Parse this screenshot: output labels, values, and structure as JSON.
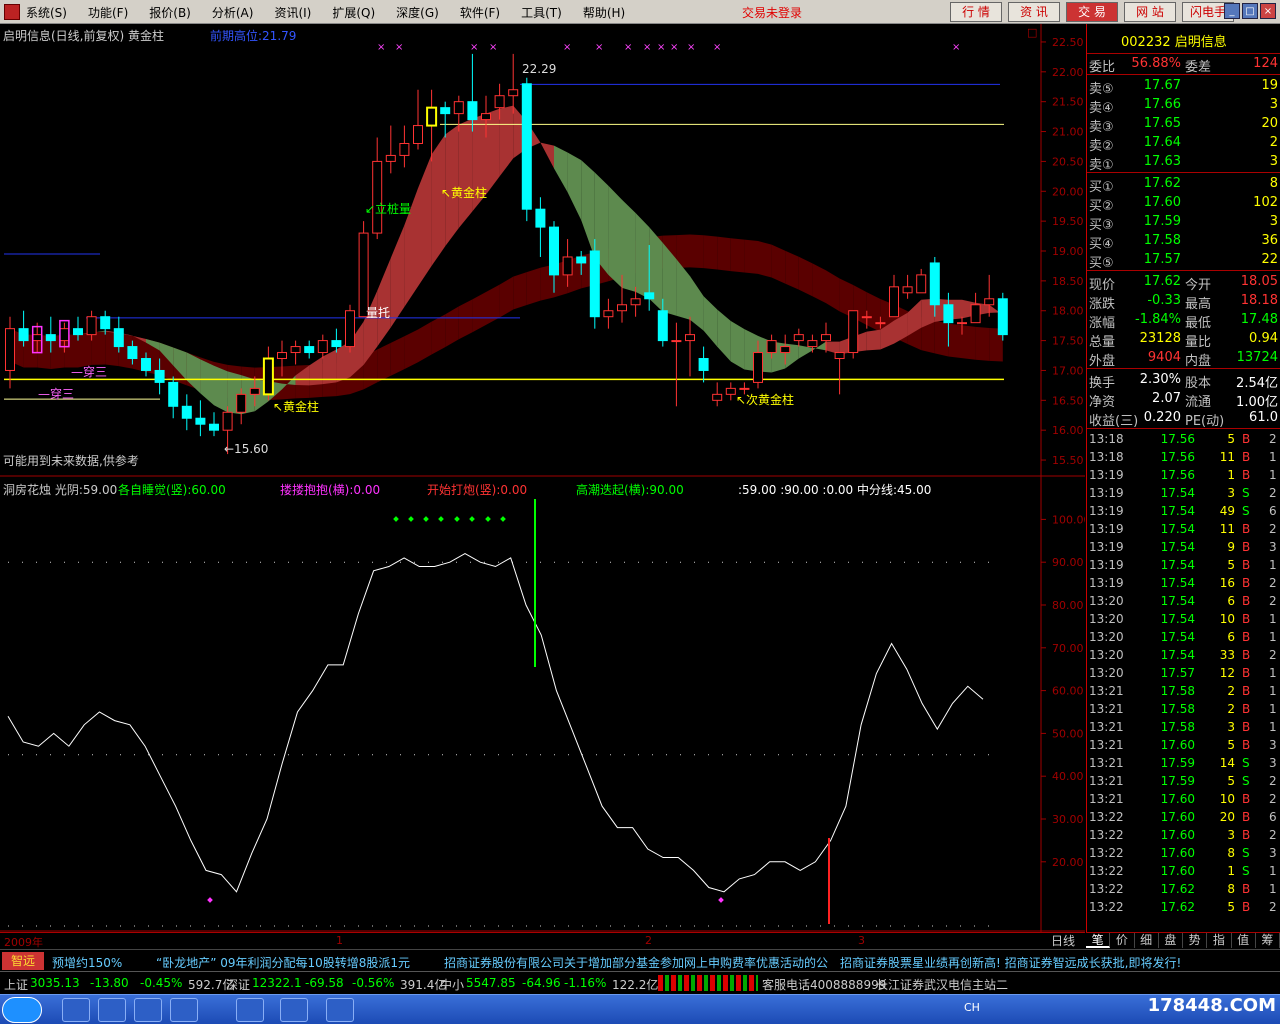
{
  "menu": {
    "items": [
      "系统(S)",
      "功能(F)",
      "报价(B)",
      "分析(A)",
      "资讯(I)",
      "扩展(Q)",
      "深度(G)",
      "软件(F)",
      "工具(T)",
      "帮助(H)"
    ],
    "login_status": "交易未登录",
    "tabs": [
      "行 情",
      "资 讯",
      "交 易",
      "网 站",
      "闪电手"
    ]
  },
  "upper_pane": {
    "title": "启明信息(日线,前复权) 黄金柱",
    "indicator": "前期高位:21.79",
    "price_axis": [
      "22.50",
      "22.00",
      "21.50",
      "21.00",
      "20.50",
      "20.00",
      "19.50",
      "19.00",
      "18.50",
      "18.00",
      "17.50",
      "17.00",
      "16.50",
      "16.00",
      "15.50"
    ],
    "annotations": {
      "high": "22.29",
      "low": "←15.60",
      "li_zhuang": "↙立桩量",
      "huangjin1": "↖黄金柱",
      "huangjin2": "↖黄金柱",
      "ci_huangjin": "↖次黄金柱",
      "liang_tuo": "量托",
      "chuan_san1": "—穿三",
      "chuan_san2": "—穿三"
    },
    "footnote": "可能用到未来数据,供参考"
  },
  "lower_pane": {
    "title": "洞房花烛 光阴:59.00",
    "legend": [
      {
        "label": "各自睡觉(竖):60.00",
        "color": "#00ff00"
      },
      {
        "label": "搂搂抱抱(横):0.00",
        "color": "#ff33ff"
      },
      {
        "label": "开始打炮(竖):0.00",
        "color": "#ff3333"
      },
      {
        "label": "高潮迭起(横):90.00",
        "color": "#00ff00"
      },
      {
        "label": ":59.00 :90.00 :0.00 中分线:45.00",
        "color": "#ffffff"
      }
    ],
    "axis": [
      "100.00",
      "90.00",
      "80.00",
      "70.00",
      "60.00",
      "50.00",
      "40.00",
      "30.00",
      "20.00"
    ]
  },
  "x_axis": {
    "year_label": "2009年",
    "month_labels": [
      "1",
      "2",
      "3"
    ]
  },
  "day_tab": "日线",
  "quote": {
    "code_name": "002232 启明信息",
    "wei_bi": {
      "label": "委比",
      "value": "56.88%",
      "label2": "委差",
      "value2": "124"
    },
    "sell": [
      {
        "label": "卖⑤",
        "price": "17.67",
        "vol": "19"
      },
      {
        "label": "卖④",
        "price": "17.66",
        "vol": "3"
      },
      {
        "label": "卖③",
        "price": "17.65",
        "vol": "20"
      },
      {
        "label": "卖②",
        "price": "17.64",
        "vol": "2"
      },
      {
        "label": "卖①",
        "price": "17.63",
        "vol": "3"
      }
    ],
    "buy": [
      {
        "label": "买①",
        "price": "17.62",
        "vol": "8"
      },
      {
        "label": "买②",
        "price": "17.60",
        "vol": "102"
      },
      {
        "label": "买③",
        "price": "17.59",
        "vol": "3"
      },
      {
        "label": "买④",
        "price": "17.58",
        "vol": "36"
      },
      {
        "label": "买⑤",
        "price": "17.57",
        "vol": "22"
      }
    ],
    "stats1": [
      {
        "l1": "现价",
        "v1": "17.62",
        "c1": "#00ff00",
        "l2": "今开",
        "v2": "18.05",
        "c2": "#ff3333"
      },
      {
        "l1": "涨跌",
        "v1": "-0.33",
        "c1": "#00ff00",
        "l2": "最高",
        "v2": "18.18",
        "c2": "#ff3333"
      },
      {
        "l1": "涨幅",
        "v1": "-1.84%",
        "c1": "#00ff00",
        "l2": "最低",
        "v2": "17.48",
        "c2": "#00ff00"
      },
      {
        "l1": "总量",
        "v1": "23128",
        "c1": "#ffff00",
        "l2": "量比",
        "v2": "0.94",
        "c2": "#ffff00"
      },
      {
        "l1": "外盘",
        "v1": "9404",
        "c1": "#ff3333",
        "l2": "内盘",
        "v2": "13724",
        "c2": "#00ff00"
      }
    ],
    "stats2": [
      {
        "l1": "换手",
        "v1": "2.30%",
        "c1": "#ffffff",
        "l2": "股本",
        "v2": "2.54亿",
        "c2": "#ffffff"
      },
      {
        "l1": "净资",
        "v1": "2.07",
        "c1": "#ffffff",
        "l2": "流通",
        "v2": "1.00亿",
        "c2": "#ffffff"
      },
      {
        "l1": "收益(三)",
        "v1": "0.220",
        "c1": "#ffffff",
        "l2": "PE(动)",
        "v2": "61.0",
        "c2": "#ffffff"
      }
    ]
  },
  "ticks": [
    {
      "t": "13:18",
      "p": "17.56",
      "v": "5",
      "f": "B",
      "n": "2"
    },
    {
      "t": "13:18",
      "p": "17.56",
      "v": "11",
      "f": "B",
      "n": "1"
    },
    {
      "t": "13:19",
      "p": "17.56",
      "v": "1",
      "f": "B",
      "n": "1"
    },
    {
      "t": "13:19",
      "p": "17.54",
      "v": "3",
      "f": "S",
      "n": "2"
    },
    {
      "t": "13:19",
      "p": "17.54",
      "v": "49",
      "f": "S",
      "n": "6"
    },
    {
      "t": "13:19",
      "p": "17.54",
      "v": "11",
      "f": "B",
      "n": "2"
    },
    {
      "t": "13:19",
      "p": "17.54",
      "v": "9",
      "f": "B",
      "n": "3"
    },
    {
      "t": "13:19",
      "p": "17.54",
      "v": "5",
      "f": "B",
      "n": "1"
    },
    {
      "t": "13:19",
      "p": "17.54",
      "v": "16",
      "f": "B",
      "n": "2"
    },
    {
      "t": "13:20",
      "p": "17.54",
      "v": "6",
      "f": "B",
      "n": "2"
    },
    {
      "t": "13:20",
      "p": "17.54",
      "v": "10",
      "f": "B",
      "n": "1"
    },
    {
      "t": "13:20",
      "p": "17.54",
      "v": "6",
      "f": "B",
      "n": "1"
    },
    {
      "t": "13:20",
      "p": "17.54",
      "v": "33",
      "f": "B",
      "n": "2"
    },
    {
      "t": "13:20",
      "p": "17.57",
      "v": "12",
      "f": "B",
      "n": "1"
    },
    {
      "t": "13:21",
      "p": "17.58",
      "v": "2",
      "f": "B",
      "n": "1"
    },
    {
      "t": "13:21",
      "p": "17.58",
      "v": "2",
      "f": "B",
      "n": "1"
    },
    {
      "t": "13:21",
      "p": "17.58",
      "v": "3",
      "f": "B",
      "n": "1"
    },
    {
      "t": "13:21",
      "p": "17.60",
      "v": "5",
      "f": "B",
      "n": "3"
    },
    {
      "t": "13:21",
      "p": "17.59",
      "v": "14",
      "f": "S",
      "n": "3"
    },
    {
      "t": "13:21",
      "p": "17.59",
      "v": "5",
      "f": "S",
      "n": "2"
    },
    {
      "t": "13:21",
      "p": "17.60",
      "v": "10",
      "f": "B",
      "n": "2"
    },
    {
      "t": "13:22",
      "p": "17.60",
      "v": "20",
      "f": "B",
      "n": "6"
    },
    {
      "t": "13:22",
      "p": "17.60",
      "v": "3",
      "f": "B",
      "n": "2"
    },
    {
      "t": "13:22",
      "p": "17.60",
      "v": "8",
      "f": "S",
      "n": "3"
    },
    {
      "t": "13:22",
      "p": "17.60",
      "v": "1",
      "f": "S",
      "n": "1"
    },
    {
      "t": "13:22",
      "p": "17.62",
      "v": "8",
      "f": "B",
      "n": "1"
    },
    {
      "t": "13:22",
      "p": "17.62",
      "v": "5",
      "f": "B",
      "n": "2"
    }
  ],
  "right_tabs": [
    "笔",
    "价",
    "细",
    "盘",
    "势",
    "指",
    "值",
    "筹"
  ],
  "news": {
    "badge": "智远",
    "items": [
      "预增约150%",
      "“卧龙地产” 09年利润分配每10股转增8股派1元",
      "招商证券股份有限公司关于增加部分基金参加网上申购费率优惠活动的公",
      "招商证券股票星业绩再创新高! 招商证券智远成长获批,即将发行!"
    ]
  },
  "status": {
    "sh_label": "上证",
    "sh_value": "3035.13",
    "sh_chg": "-13.80",
    "sh_pct": "-0.45%",
    "sh_amt": "592.7亿",
    "sz_label": "深证",
    "sz_value": "12322.1",
    "sz_chg": "-69.58",
    "sz_pct": "-0.56%",
    "sz_amt": "391.4亿",
    "zx_label": "中小",
    "zx_value": "5547.85",
    "zx_chg": "-64.96",
    "zx_pct": "-1.16%",
    "zx_amt": "122.2亿",
    "phone": "客服电话4008888999",
    "server": "长江证券武汉电信主站二"
  },
  "taskbar": {
    "ime": "CH",
    "site": "178448.COM"
  },
  "colors": {
    "up": "#ff3333",
    "down": "#00ffff",
    "green": "#00ff00",
    "yellow": "#ffff00"
  },
  "chart_data": {
    "type": "candlestick",
    "title": "启明信息(日线,前复权) 黄金柱",
    "ylim": [
      15.3,
      22.7
    ],
    "candles": [
      [
        17.0,
        17.9,
        16.7,
        17.7
      ],
      [
        17.7,
        18.0,
        17.4,
        17.5
      ],
      [
        17.5,
        17.8,
        17.3,
        17.6
      ],
      [
        17.6,
        17.9,
        17.3,
        17.5
      ],
      [
        17.5,
        17.8,
        17.3,
        17.7
      ],
      [
        17.7,
        17.9,
        17.5,
        17.6
      ],
      [
        17.6,
        18.0,
        17.5,
        17.9
      ],
      [
        17.9,
        18.0,
        17.6,
        17.7
      ],
      [
        17.7,
        17.9,
        17.3,
        17.4
      ],
      [
        17.4,
        17.5,
        17.1,
        17.2
      ],
      [
        17.2,
        17.3,
        16.9,
        17.0
      ],
      [
        17.0,
        17.2,
        16.6,
        16.8
      ],
      [
        16.8,
        16.9,
        16.2,
        16.4
      ],
      [
        16.4,
        16.6,
        16.0,
        16.2
      ],
      [
        16.2,
        16.5,
        15.9,
        16.1
      ],
      [
        16.1,
        16.3,
        15.9,
        16.0
      ],
      [
        16.0,
        16.4,
        15.6,
        16.3
      ],
      [
        16.3,
        16.7,
        16.1,
        16.6
      ],
      [
        16.6,
        16.9,
        16.4,
        16.7
      ],
      [
        16.6,
        17.4,
        16.5,
        17.2
      ],
      [
        17.2,
        17.5,
        16.9,
        17.3
      ],
      [
        17.3,
        17.5,
        17.1,
        17.4
      ],
      [
        17.4,
        17.5,
        17.2,
        17.3
      ],
      [
        17.3,
        17.6,
        17.2,
        17.5
      ],
      [
        17.5,
        17.7,
        17.3,
        17.4
      ],
      [
        17.4,
        18.1,
        17.3,
        18.0
      ],
      [
        17.9,
        19.5,
        17.9,
        19.3
      ],
      [
        19.3,
        20.9,
        19.2,
        20.5
      ],
      [
        20.5,
        21.1,
        20.3,
        20.6
      ],
      [
        20.6,
        21.1,
        20.4,
        20.8
      ],
      [
        20.8,
        21.7,
        20.7,
        21.1
      ],
      [
        21.1,
        21.7,
        20.5,
        21.4
      ],
      [
        21.4,
        21.5,
        20.9,
        21.3
      ],
      [
        21.3,
        21.6,
        21.0,
        21.5
      ],
      [
        21.5,
        22.3,
        21.0,
        21.2
      ],
      [
        21.2,
        21.6,
        20.9,
        21.3
      ],
      [
        21.4,
        21.8,
        21.2,
        21.6
      ],
      [
        21.6,
        22.3,
        21.3,
        21.7
      ],
      [
        21.8,
        21.9,
        19.5,
        19.7
      ],
      [
        19.7,
        19.9,
        18.9,
        19.4
      ],
      [
        19.4,
        19.5,
        18.3,
        18.6
      ],
      [
        18.6,
        19.2,
        18.4,
        18.9
      ],
      [
        18.9,
        19.0,
        18.6,
        18.8
      ],
      [
        19.0,
        19.2,
        17.7,
        17.9
      ],
      [
        17.9,
        18.2,
        17.7,
        18.0
      ],
      [
        18.0,
        18.6,
        17.8,
        18.1
      ],
      [
        18.1,
        18.4,
        17.9,
        18.2
      ],
      [
        18.3,
        19.1,
        18.0,
        18.2
      ],
      [
        18.0,
        18.2,
        17.4,
        17.5
      ],
      [
        17.5,
        17.8,
        16.4,
        17.5
      ],
      [
        17.5,
        17.9,
        16.9,
        17.6
      ],
      [
        17.2,
        17.4,
        16.8,
        17.0
      ],
      [
        16.5,
        16.8,
        16.4,
        16.6
      ],
      [
        16.6,
        16.8,
        16.5,
        16.7
      ],
      [
        16.7,
        16.8,
        16.6,
        16.7
      ],
      [
        16.8,
        17.5,
        16.7,
        17.3
      ],
      [
        17.3,
        17.6,
        17.2,
        17.5
      ],
      [
        17.3,
        17.6,
        17.1,
        17.4
      ],
      [
        17.5,
        17.7,
        17.4,
        17.6
      ],
      [
        17.4,
        17.6,
        17.3,
        17.5
      ],
      [
        17.5,
        17.8,
        17.3,
        17.6
      ],
      [
        17.2,
        17.3,
        16.6,
        17.3
      ],
      [
        17.3,
        18.0,
        17.2,
        18.0
      ],
      [
        17.9,
        18.0,
        17.7,
        17.9
      ],
      [
        17.8,
        17.9,
        17.7,
        17.8
      ],
      [
        17.9,
        18.6,
        17.9,
        18.4
      ],
      [
        18.3,
        18.6,
        18.2,
        18.4
      ],
      [
        18.3,
        18.7,
        18.4,
        18.6
      ],
      [
        18.8,
        18.9,
        17.9,
        18.1
      ],
      [
        18.1,
        18.3,
        17.4,
        17.8
      ],
      [
        17.8,
        17.9,
        17.6,
        17.8
      ],
      [
        17.8,
        18.3,
        17.8,
        18.1
      ],
      [
        18.1,
        18.6,
        17.9,
        18.2
      ],
      [
        18.2,
        18.3,
        17.5,
        17.6
      ]
    ],
    "oscillator": [
      54,
      48,
      47,
      50,
      47,
      52,
      55,
      53,
      52,
      47,
      40,
      33,
      25,
      18,
      17,
      13,
      22,
      30,
      43,
      55,
      60,
      66,
      66,
      78,
      88,
      89,
      91,
      89,
      89,
      90,
      92,
      90,
      89,
      91,
      80,
      73,
      60,
      51,
      42,
      33,
      28,
      28,
      23,
      21,
      21,
      18,
      14,
      13,
      16,
      17,
      20,
      20,
      18,
      20,
      25,
      33,
      52,
      64,
      71,
      65,
      57,
      51,
      57,
      61,
      58
    ]
  }
}
